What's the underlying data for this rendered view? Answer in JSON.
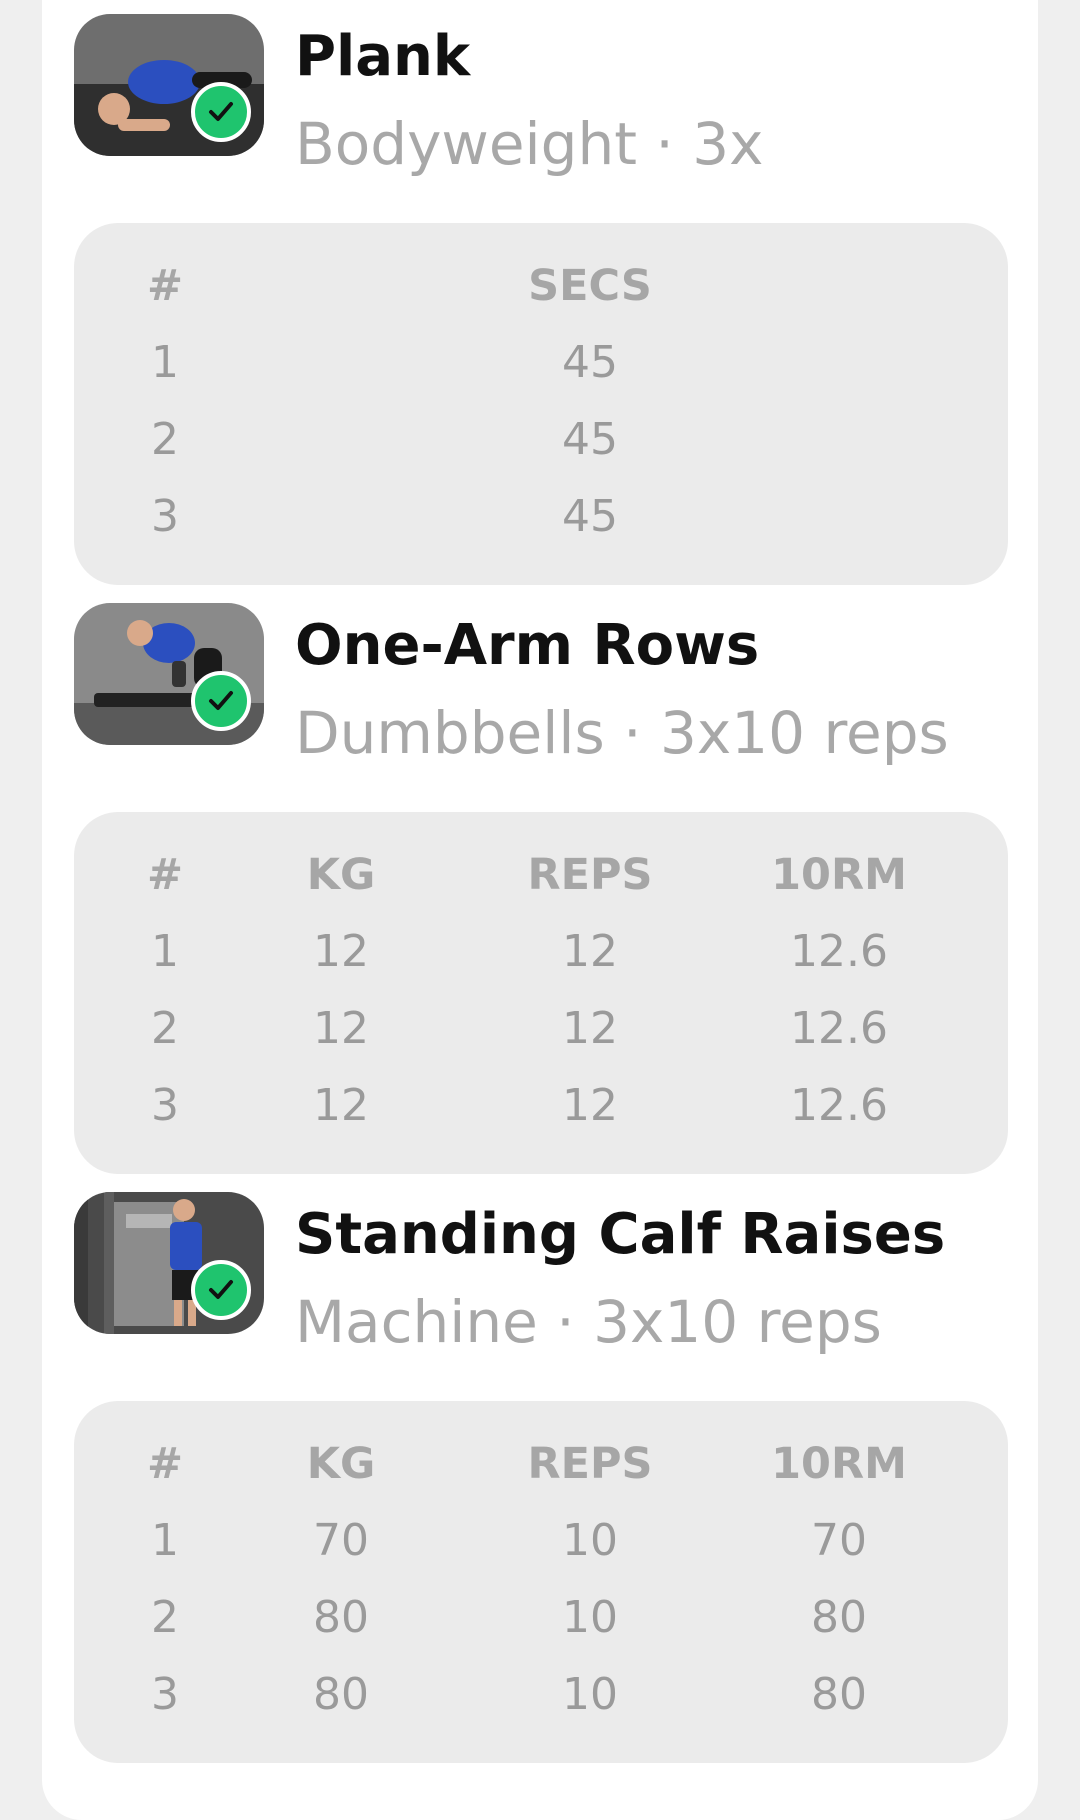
{
  "exercises": [
    {
      "title": "Plank",
      "subtitle": "Bodyweight · 3x",
      "thumb_icon": "plank-photo",
      "completed_icon": "check-circle-icon",
      "columns": [
        "#",
        "SECS"
      ],
      "sets": [
        [
          "1",
          "45"
        ],
        [
          "2",
          "45"
        ],
        [
          "3",
          "45"
        ]
      ]
    },
    {
      "title": "One-Arm Rows",
      "subtitle": "Dumbbells · 3x10 reps",
      "thumb_icon": "one-arm-rows-photo",
      "completed_icon": "check-circle-icon",
      "columns": [
        "#",
        "KG",
        "REPS",
        "10RM"
      ],
      "sets": [
        [
          "1",
          "12",
          "12",
          "12.6"
        ],
        [
          "2",
          "12",
          "12",
          "12.6"
        ],
        [
          "3",
          "12",
          "12",
          "12.6"
        ]
      ]
    },
    {
      "title": "Standing Calf Raises",
      "subtitle": "Machine · 3x10 reps",
      "thumb_icon": "calf-raises-photo",
      "completed_icon": "check-circle-icon",
      "columns": [
        "#",
        "KG",
        "REPS",
        "10RM"
      ],
      "sets": [
        [
          "1",
          "70",
          "10",
          "70"
        ],
        [
          "2",
          "80",
          "10",
          "80"
        ],
        [
          "3",
          "80",
          "10",
          "80"
        ]
      ]
    }
  ],
  "colors": {
    "check_green": "#1fc46e",
    "title": "#111111",
    "subtitle": "#a8a8a8",
    "table_bg": "#ebebeb",
    "page_bg": "#efefef"
  }
}
